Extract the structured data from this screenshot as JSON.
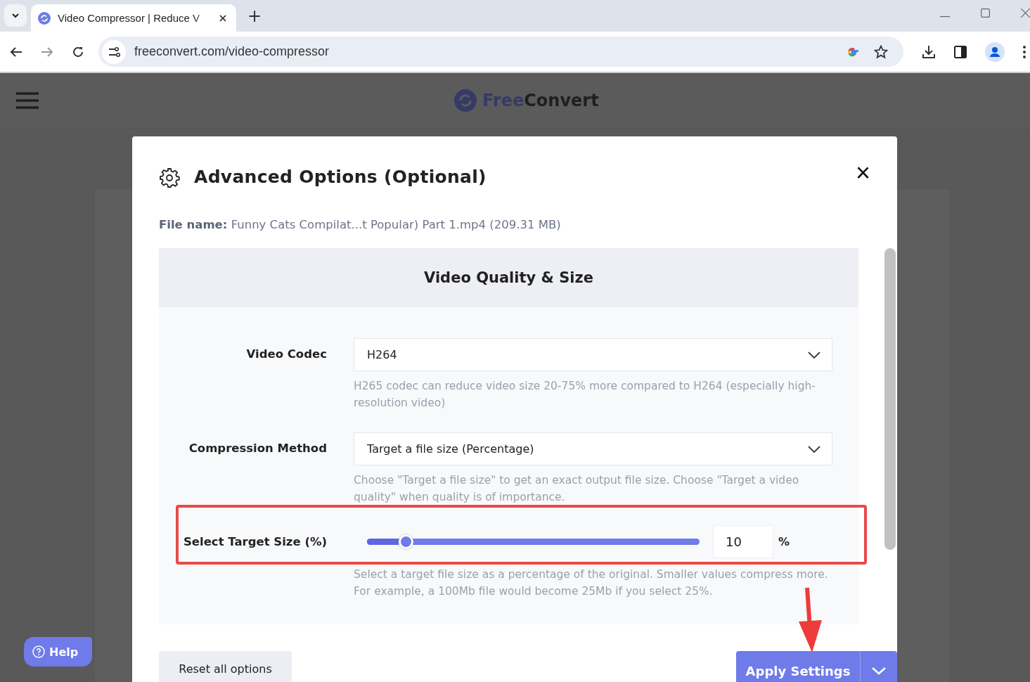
{
  "browser": {
    "tab": {
      "title": "Video Compressor | Reduce V",
      "selected": true
    },
    "new_tab": "+",
    "url": "freeconvert.com/video-compressor"
  },
  "site": {
    "logo": [
      "Free",
      "Convert"
    ]
  },
  "modal": {
    "title": "Advanced Options (Optional)",
    "close": "×",
    "file_label": "File name:",
    "file_name": "Funny Cats Compilat...t Popular) Part 1.mp4 (209.31 MB)",
    "section_title": "Video Quality & Size",
    "fields": [
      {
        "kind": "select",
        "label": "Video Codec",
        "value": "H264",
        "hint": "H265 codec can reduce video size 20-75% more compared to H264 (especially high-resolution video)"
      },
      {
        "kind": "select",
        "label": "Compression Method",
        "value": "Target a file size (Percentage)",
        "hint": "Choose \"Target a file size\" to get an exact output file size. Choose \"Target a video quality\" when quality is of importance."
      },
      {
        "kind": "slider",
        "label": "Select Target Size (%)",
        "level": 0.1,
        "value": "10",
        "unit": "%",
        "hint": "Select a target file size as a percentage of the original. Smaller values compress more. For example, a 100Mb file would become 25Mb if you select 25%."
      }
    ],
    "reset_button": "Reset all options",
    "apply_button": "Apply Settings"
  },
  "help_button": "Help"
}
